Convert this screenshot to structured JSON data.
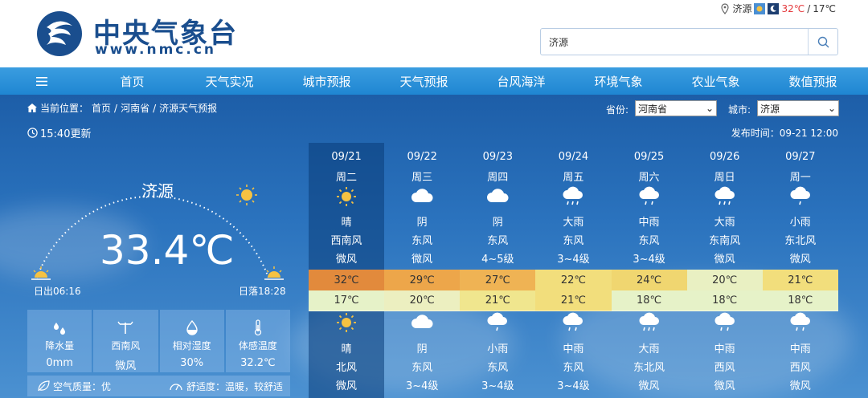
{
  "header": {
    "site_title": "中央气象台",
    "site_url": "www.nmc.cn",
    "location": "济源",
    "high_temp": "32℃",
    "low_temp": "17℃",
    "search_value": "济源"
  },
  "nav": {
    "items": [
      "首页",
      "天气实况",
      "城市预报",
      "天气预报",
      "台风海洋",
      "环境气象",
      "农业气象",
      "数值预报"
    ]
  },
  "breadcrumb": {
    "prefix": "当前位置：",
    "items": [
      "首页",
      "河南省",
      "济源天气预报"
    ]
  },
  "selectors": {
    "province_label": "省份:",
    "province_value": "河南省",
    "city_label": "城市:",
    "city_value": "济源"
  },
  "update_time": "15:40更新",
  "publish_time": "发布时间：09-21 12:00",
  "current": {
    "city": "济源",
    "temperature": "33.4℃",
    "sunrise": "日出06:16",
    "sunset": "日落18:28"
  },
  "stats": [
    {
      "label": "降水量",
      "value": "0mm",
      "icon": "raindrops-icon"
    },
    {
      "label": "西南风",
      "value": "微风",
      "icon": "wind-vane-icon"
    },
    {
      "label": "相对湿度",
      "value": "30%",
      "icon": "humidity-drop-icon"
    },
    {
      "label": "体感温度",
      "value": "32.2℃",
      "icon": "thermometer-icon"
    }
  ],
  "aqi": {
    "air_quality": "空气质量：优",
    "comfort": "舒适度：温暖，较舒适"
  },
  "forecast": [
    {
      "date": "09/21",
      "weekday": "周二",
      "day_weather": "晴",
      "day_wind_dir": "西南风",
      "day_wind_power": "微风",
      "high": "32℃",
      "low": "17℃",
      "night_weather": "晴",
      "night_wind_dir": "北风",
      "night_wind_power": "微风",
      "day_icon": "sun-icon",
      "night_icon": "sun-icon",
      "high_color": "#e28a3c",
      "low_color": "#e6f2c8"
    },
    {
      "date": "09/22",
      "weekday": "周三",
      "day_weather": "阴",
      "day_wind_dir": "东风",
      "day_wind_power": "微风",
      "high": "29℃",
      "low": "20℃",
      "night_weather": "阴",
      "night_wind_dir": "东风",
      "night_wind_power": "3~4级",
      "day_icon": "cloud-icon",
      "night_icon": "cloud-icon",
      "high_color": "#eda64a",
      "low_color": "#ecefc0"
    },
    {
      "date": "09/23",
      "weekday": "周四",
      "day_weather": "阴",
      "day_wind_dir": "东风",
      "day_wind_power": "4~5级",
      "high": "27℃",
      "low": "21℃",
      "night_weather": "小雨",
      "night_wind_dir": "东风",
      "night_wind_power": "3~4级",
      "day_icon": "cloud-icon",
      "night_icon": "light-rain-icon",
      "high_color": "#efb354",
      "low_color": "#f0e68e"
    },
    {
      "date": "09/24",
      "weekday": "周五",
      "day_weather": "大雨",
      "day_wind_dir": "东风",
      "day_wind_power": "3~4级",
      "high": "22℃",
      "low": "21℃",
      "night_weather": "中雨",
      "night_wind_dir": "东风",
      "night_wind_power": "3~4级",
      "day_icon": "heavy-rain-icon",
      "night_icon": "moderate-rain-icon",
      "high_color": "#f2de7c",
      "low_color": "#f2de7c"
    },
    {
      "date": "09/25",
      "weekday": "周六",
      "day_weather": "中雨",
      "day_wind_dir": "东风",
      "day_wind_power": "3~4级",
      "high": "24℃",
      "low": "18℃",
      "night_weather": "大雨",
      "night_wind_dir": "东北风",
      "night_wind_power": "微风",
      "day_icon": "moderate-rain-icon",
      "night_icon": "heavy-rain-icon",
      "high_color": "#f0d670",
      "low_color": "#e6f2c8"
    },
    {
      "date": "09/26",
      "weekday": "周日",
      "day_weather": "大雨",
      "day_wind_dir": "东南风",
      "day_wind_power": "微风",
      "high": "20℃",
      "low": "18℃",
      "night_weather": "中雨",
      "night_wind_dir": "西风",
      "night_wind_power": "微风",
      "day_icon": "heavy-rain-icon",
      "night_icon": "moderate-rain-icon",
      "high_color": "#e9f0c2",
      "low_color": "#e6f2c8"
    },
    {
      "date": "09/27",
      "weekday": "周一",
      "day_weather": "小雨",
      "day_wind_dir": "东北风",
      "day_wind_power": "微风",
      "high": "21℃",
      "low": "18℃",
      "night_weather": "中雨",
      "night_wind_dir": "西风",
      "night_wind_power": "微风",
      "day_icon": "light-rain-icon",
      "night_icon": "moderate-rain-icon",
      "high_color": "#f2de7c",
      "low_color": "#e6f2c8"
    }
  ]
}
